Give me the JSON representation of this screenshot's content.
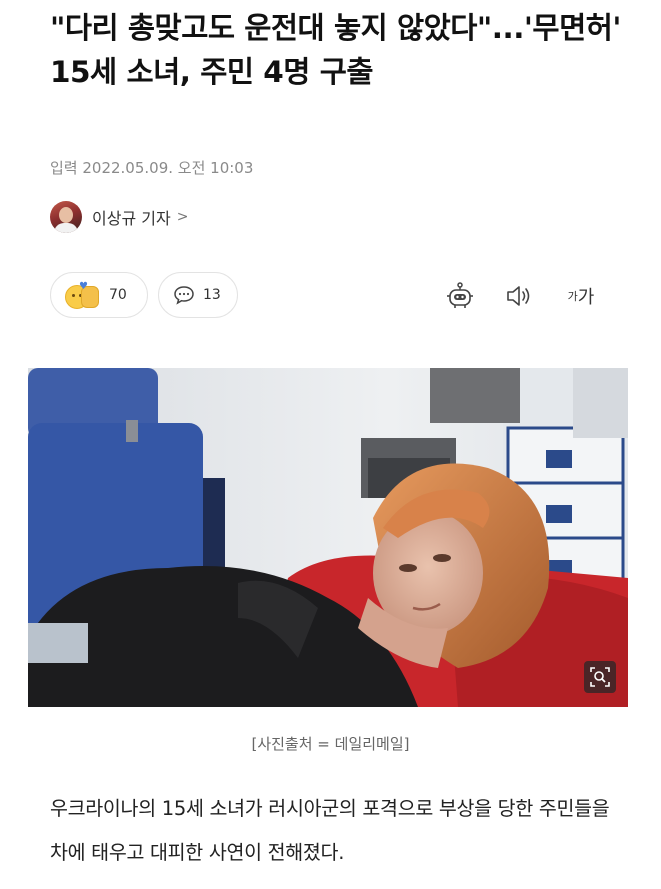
{
  "article": {
    "headline": "\"다리 총맞고도 운전대 놓지 않았다\"...'무면허' 15세 소녀, 주민 4명 구출",
    "date_line": "입력 2022.05.09. 오전 10:03",
    "reporter": {
      "name": "이상규 기자",
      "chevron": ">"
    },
    "reactions": {
      "count": "70",
      "icon": "emoji-reaction-icon"
    },
    "comments": {
      "count": "13",
      "icon": "speech-bubble-icon"
    },
    "tools": {
      "robot": "robot-summary-icon",
      "speaker": "speaker-icon",
      "font_small": "가",
      "font_big": "가"
    },
    "photo": {
      "caption": "[사진출처 = 데일리메일]",
      "icon": "magnifier-icon"
    },
    "body": "우크라이나의 15세 소녀가 러시아군의 포격으로 부상을 당한 주민들을 차에 태우고 대피한 사연이 전해졌다."
  }
}
